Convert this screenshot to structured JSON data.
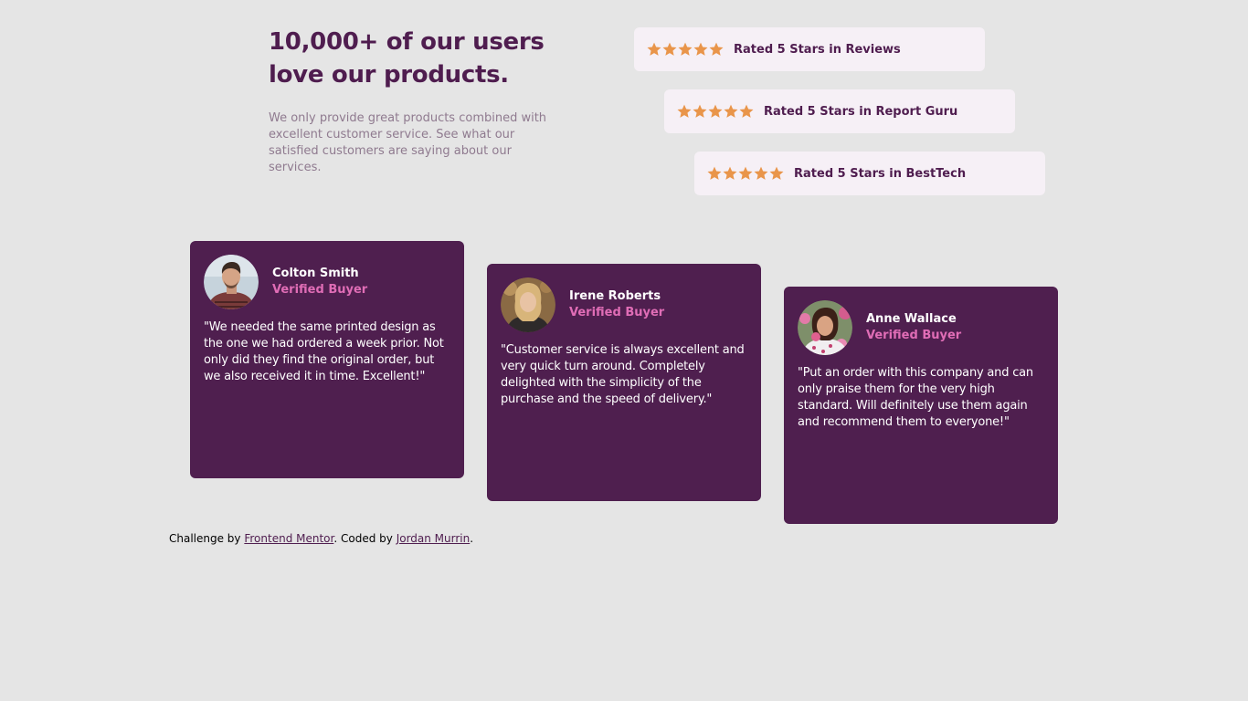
{
  "intro": {
    "heading": "10,000+ of our users love our products.",
    "description": "We only provide great products combined with excellent customer service. See what our satisfied customers are saying about our services."
  },
  "ratings": [
    {
      "stars": 5,
      "label": "Rated 5 Stars in Reviews"
    },
    {
      "stars": 5,
      "label": "Rated 5 Stars in Report Guru"
    },
    {
      "stars": 5,
      "label": "Rated 5 Stars in BestTech"
    }
  ],
  "testimonials": [
    {
      "name": "Colton Smith",
      "status": "Verified Buyer",
      "quote": "\"We needed the same printed design as the one we had ordered a week prior. Not only did they find the original order, but we also received it in time. Excellent!\""
    },
    {
      "name": "Irene Roberts",
      "status": "Verified Buyer",
      "quote": "\"Customer service is always excellent and very quick turn around. Completely delighted with the simplicity of the purchase and the speed of delivery.\""
    },
    {
      "name": "Anne Wallace",
      "status": "Verified Buyer",
      "quote": "\"Put an order with this company and can only praise them for the very high standard. Will definitely use them again and recommend them to everyone!\""
    }
  ],
  "attribution": {
    "prefix": "Challenge by",
    "challenge_link": "Frontend Mentor",
    "middle": ". Coded by",
    "author_link": "Jordan Murrin",
    "suffix": "."
  },
  "colors": {
    "background": "#e5e5e5",
    "dark_magenta": "#4f1d4f",
    "card_background": "#4f1f4f",
    "rating_background": "#f6f0f6",
    "star": "#e9954a",
    "verified_pink": "#e06db6",
    "muted_text": "#8f7a8f"
  },
  "icons": {
    "rating_star": "star-icon"
  }
}
